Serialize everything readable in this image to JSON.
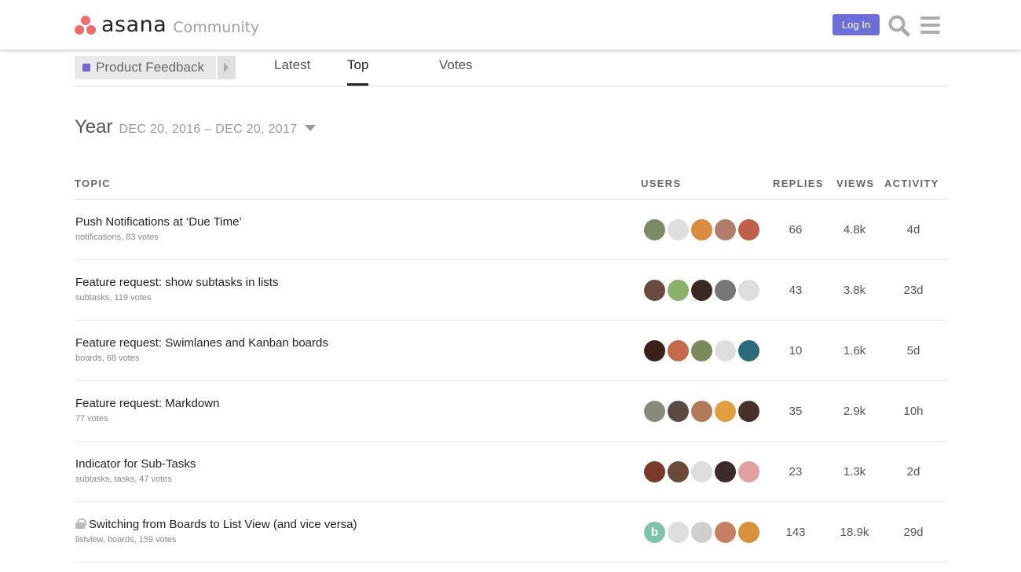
{
  "header": {
    "brand": "asana",
    "subtitle": "Community",
    "login_label": "Log In"
  },
  "nav": {
    "category": "Product Feedback",
    "category_color": "#7a67d6",
    "tabs": [
      {
        "label": "Latest",
        "active": false
      },
      {
        "label": "Top",
        "active": true
      },
      {
        "label": "Votes",
        "active": false
      }
    ]
  },
  "period": {
    "title": "Year",
    "range": "DEC 20, 2016 – DEC 20, 2017"
  },
  "table": {
    "headers": {
      "topic": "TOPIC",
      "users": "USERS",
      "replies": "REPLIES",
      "views": "VIEWS",
      "activity": "ACTIVITY"
    },
    "rows": [
      {
        "title": "Push Notifications at ‘Due Time’",
        "meta": "notifications, 83 votes",
        "locked": false,
        "replies": "66",
        "views": "4.8k",
        "activity": "4d",
        "avatars": [
          "#7d8a66",
          "#dedede",
          "#d98b3f",
          "#b07d6a",
          "#c0604a"
        ]
      },
      {
        "title": "Feature request: show subtasks in lists",
        "meta": "subtasks, 119 votes",
        "locked": false,
        "replies": "43",
        "views": "3.8k",
        "activity": "23d",
        "avatars": [
          "#6b4a3f",
          "#8bb06a",
          "#3a2a22",
          "#777777",
          "#dedede"
        ]
      },
      {
        "title": "Feature request: Swimlanes and Kanban boards",
        "meta": "boards, 68 votes",
        "locked": false,
        "replies": "10",
        "views": "1.6k",
        "activity": "5d",
        "avatars": [
          "#3a2018",
          "#c46a4a",
          "#7a8a5a",
          "#dedede",
          "#2a6a7a"
        ]
      },
      {
        "title": "Feature request: Markdown",
        "meta": "77 votes",
        "locked": false,
        "replies": "35",
        "views": "2.9k",
        "activity": "10h",
        "avatars": [
          "#8a8a7a",
          "#5a4a42",
          "#b07a5a",
          "#e0a040",
          "#4a3028"
        ]
      },
      {
        "title": "Indicator for Sub-Tasks",
        "meta": "subtasks, tasks, 47 votes",
        "locked": false,
        "replies": "23",
        "views": "1.3k",
        "activity": "2d",
        "avatars": [
          "#7a3a2a",
          "#6a4a3a",
          "#dedede",
          "#3a2a2a",
          "#e0a0a0"
        ]
      },
      {
        "title": "Switching from Boards to List View (and vice versa)",
        "meta": "listview, boards, 159 votes",
        "locked": true,
        "replies": "143",
        "views": "18.9k",
        "activity": "29d",
        "avatars": [
          "#7fc4a8",
          "#dedede",
          "#cfcfcf",
          "#c48060",
          "#d8903a"
        ],
        "first_avatar_letter": "b"
      }
    ]
  }
}
